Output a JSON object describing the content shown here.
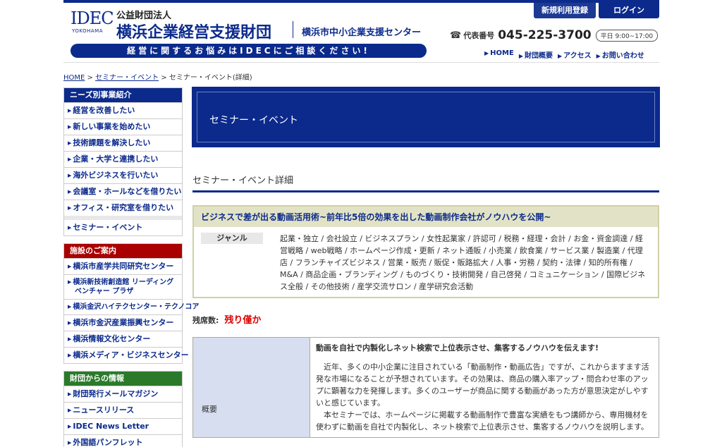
{
  "header": {
    "logo": "IDEC",
    "logo_sub": "YOKOHAMA",
    "org_type": "公益財団法人",
    "org_name": "横浜企業経営支援財団",
    "org_sub": "横浜市中小企業支援センター",
    "catch": "経営に関するお悩みはIDECにご相談ください!",
    "register_label": "新規利用登録",
    "login_label": "ログイン",
    "phone_label": "代表番号",
    "phone_number": "045-225-3700",
    "phone_hours": "平日 9:00~17:00",
    "nav": [
      "HOME",
      "財団概要",
      "アクセス",
      "お問い合わせ"
    ]
  },
  "breadcrumb": {
    "home": "HOME",
    "seminar": "セミナー・イベント",
    "current": "セミナー・イベント(詳細)"
  },
  "sidebar": {
    "needs_head": "ニーズ別事業紹介",
    "needs_items": [
      "経営を改善したい",
      "新しい事業を始めたい",
      "技術課題を解決したい",
      "企業・大学と連携したい",
      "海外ビジネスを行いたい",
      "会議室・ホールなどを借りたい",
      "オフィス・研究室を借りたい"
    ],
    "seminar_item": "セミナー・イベント",
    "facility_head": "施設のご案内",
    "facility_items": [
      "横浜市産学共同研究センター",
      "横浜新技術創造館 リーディング ベンチャー プラザ",
      "横浜金沢ハイテクセンター・テクノコア",
      "横浜市金沢産業振興センター",
      "横浜情報文化センター",
      "横浜メディア・ビジネスセンター"
    ],
    "info_head": "財団からの情報",
    "info_items": [
      "財団発行メールマガジン",
      "ニュースリリース",
      "IDEC News Letter",
      "外国語パンフレット"
    ]
  },
  "main": {
    "hero_title": "セミナー・イベント",
    "section_title": "セミナー・イベント詳細",
    "event_title": "ビジネスで差が出る動画活用術~前年比5倍の効果を出した動画制作会社がノウハウを公開~",
    "genre_label": "ジャンル",
    "genre_text": "起業・独立 / 会社設立 / ビジネスプラン / 女性起業家 / 許認可 / 税務・経理・会計 / お金・資金調達 / 経営戦略 / web戦略 / ホームページ作成・更新 / ネット通販 / 小売業 / 飲食業 / サービス業 / 製造業 / 代理店 / フランチャイズビジネス / 営業・販売 / 販促・販路拡大 / 人事・労務 / 契約・法律 / 知的所有権 / M&A / 商品企画・ブランディング / ものづくり・技術開発 / 自己啓発 / コミュニケーション / 国際ビジネス全般 / その他技術 / 産学交流サロン / 産学研究会活動",
    "seats_label": "残席数:",
    "seats_value": "残り僅か",
    "overview_label": "概要",
    "overview_lead": "動画を自社で内製化しネット検索で上位表示させ、集客するノウハウを伝えます!",
    "overview_p1": "近年、多くの中小企業に注目されている「動画制作・動画広告」ですが、これからますます活発な市場になることが予想されています。その効果は、商品の購入率アップ・問合わせ率のアップに顕著な力を発揮します。多くのユーザーが商品に関する動画があった方が意思決定がしやすいと感じています。",
    "overview_p2": "本セミナーでは、ホームページに掲載する動画制作で豊富な実績をもつ講師から、専用機材を使わずに動画を自社で内製化し、ネット検索で上位表示させ、集客するノウハウを説明します。"
  }
}
